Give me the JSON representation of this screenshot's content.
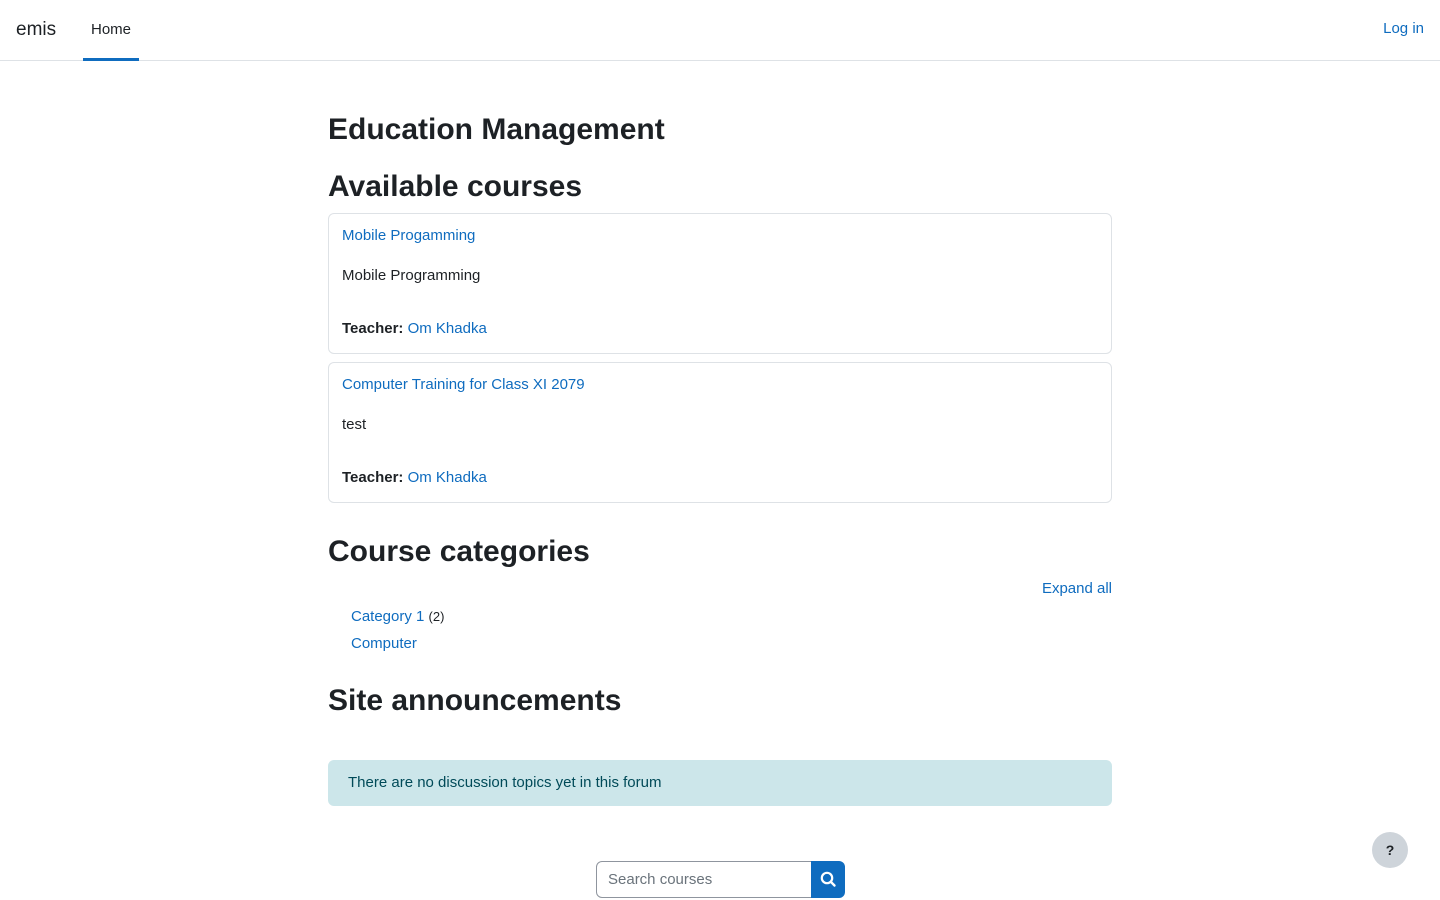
{
  "navbar": {
    "brand": "emis",
    "home": "Home",
    "login": "Log in"
  },
  "page": {
    "title": "Education Management"
  },
  "available_courses": {
    "heading": "Available courses",
    "courses": [
      {
        "title": "Mobile Progamming",
        "summary": "Mobile Programming",
        "teacher_label": "Teacher:",
        "teacher": "Om Khadka"
      },
      {
        "title": "Computer Training for Class XI 2079",
        "summary": "test",
        "teacher_label": "Teacher:",
        "teacher": "Om Khadka"
      }
    ]
  },
  "categories": {
    "heading": "Course categories",
    "expand_all": "Expand all",
    "items": [
      {
        "name": "Category 1",
        "count": "(2)"
      },
      {
        "name": "Computer",
        "count": ""
      }
    ]
  },
  "announcements": {
    "heading": "Site announcements",
    "empty_message": "There are no discussion topics yet in this forum"
  },
  "search": {
    "placeholder": "Search courses",
    "icon": "search-icon"
  },
  "help": {
    "label": "?"
  },
  "colors": {
    "link": "#0f6cbf",
    "alert_bg": "#cce6ea",
    "alert_text": "#004a58"
  }
}
